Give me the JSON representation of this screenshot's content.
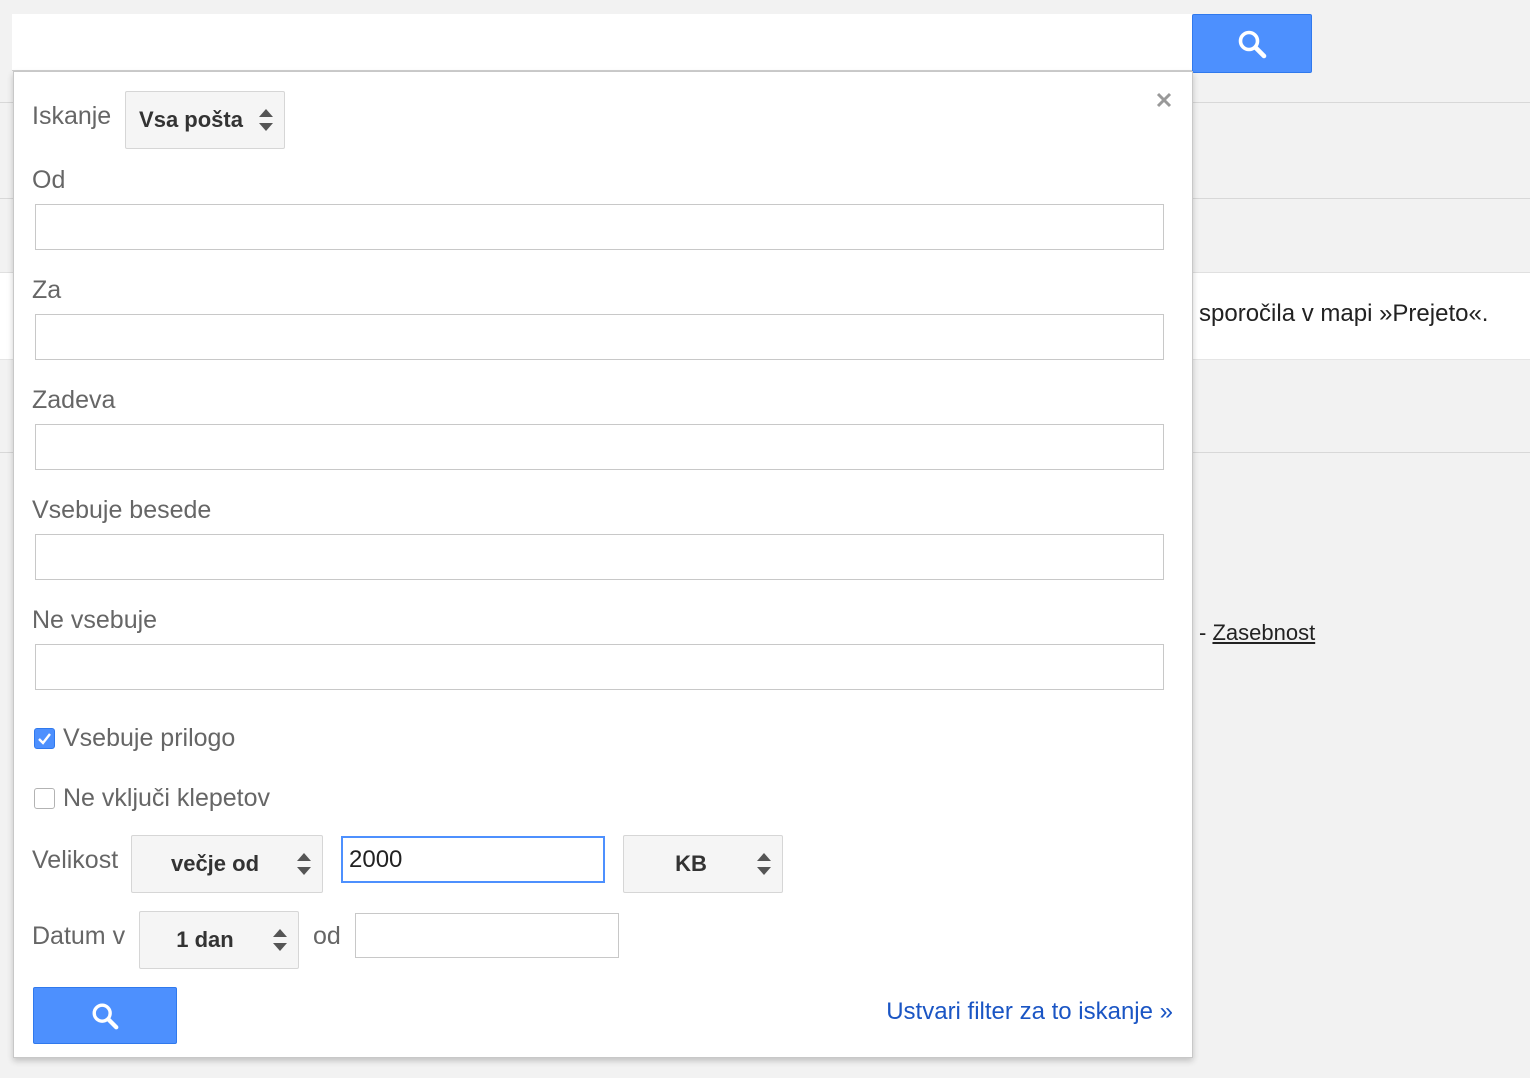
{
  "search": {
    "query": "",
    "button_icon": "search-icon"
  },
  "background": {
    "message_text": "sporočila v mapi »Prejeto«.",
    "footer_separator": "- ",
    "privacy_link": "Zasebnost"
  },
  "panel": {
    "search_in_label": "Iskanje",
    "search_in_value": "Vsa pošta",
    "close_icon": "close-icon",
    "from_label": "Od",
    "from_value": "",
    "to_label": "Za",
    "to_value": "",
    "subject_label": "Zadeva",
    "subject_value": "",
    "has_words_label": "Vsebuje besede",
    "has_words_value": "",
    "doesnt_have_label": "Ne vsebuje",
    "doesnt_have_value": "",
    "has_attachment_label": "Vsebuje prilogo",
    "has_attachment_checked": true,
    "exclude_chats_label": "Ne vključi klepetov",
    "exclude_chats_checked": false,
    "size_label": "Velikost",
    "size_operator": "večje od",
    "size_value": "2000",
    "size_unit": "KB",
    "date_within_label": "Datum v",
    "date_within_value": "1 dan",
    "date_of_label": "od",
    "date_of_value": "",
    "search_button_icon": "search-icon",
    "create_filter_link": "Ustvari filter za to iskanje »"
  },
  "colors": {
    "accent_blue": "#4d90fe",
    "link_blue": "#1a55c4"
  }
}
